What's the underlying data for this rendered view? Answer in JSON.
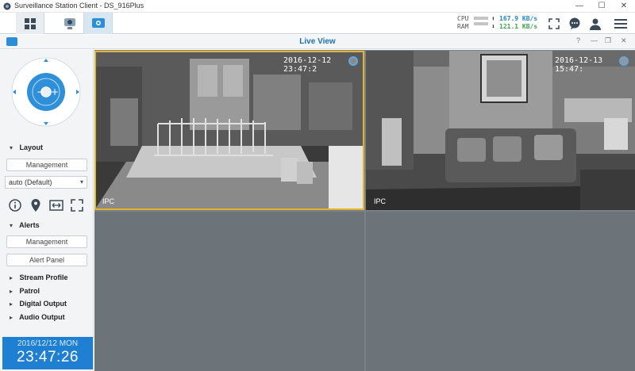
{
  "window": {
    "title": "Surveillance Station Client - DS_916Plus",
    "buttons": {
      "minimize": "—",
      "maximize": "☐",
      "close": "✕"
    }
  },
  "toolbar": {
    "tabs": [
      {
        "icon": "grid-apps-icon"
      },
      {
        "icon": "camera-device-icon"
      },
      {
        "icon": "live-view-icon"
      }
    ],
    "stats": {
      "cpu_label": "CPU",
      "ram_label": "RAM",
      "upload": "167.9 KB/s",
      "download": "121.1 KB/s"
    },
    "right_icons": [
      "fullscreen-icon",
      "chat-icon",
      "user-icon",
      "menu-icon"
    ]
  },
  "live_view": {
    "title": "Live View",
    "header_buttons": [
      "?",
      "—",
      "❐",
      "✕"
    ]
  },
  "sidebar": {
    "layout": {
      "heading": "Layout",
      "management_button": "Management",
      "select_value": "auto (Default)"
    },
    "alerts": {
      "heading": "Alerts",
      "management_button": "Management",
      "alert_panel_button": "Alert Panel"
    },
    "sections": [
      "Stream Profile",
      "Patrol",
      "Digital Output",
      "Audio Output"
    ],
    "clock": {
      "date": "2016/12/12 MON",
      "time": "23:47:26"
    }
  },
  "feeds": [
    {
      "timestamp": "2016-12-12 23:47:2",
      "label": "IPC",
      "selected": true,
      "scene": "kitchen"
    },
    {
      "timestamp": "2016-12-13 15:47:",
      "label": "IPC",
      "selected": false,
      "scene": "living-room"
    }
  ],
  "colors": {
    "accent": "#1f7fd3",
    "selected_border": "#e6b32d",
    "upload": "#1c86d8",
    "download": "#3aa64a"
  }
}
